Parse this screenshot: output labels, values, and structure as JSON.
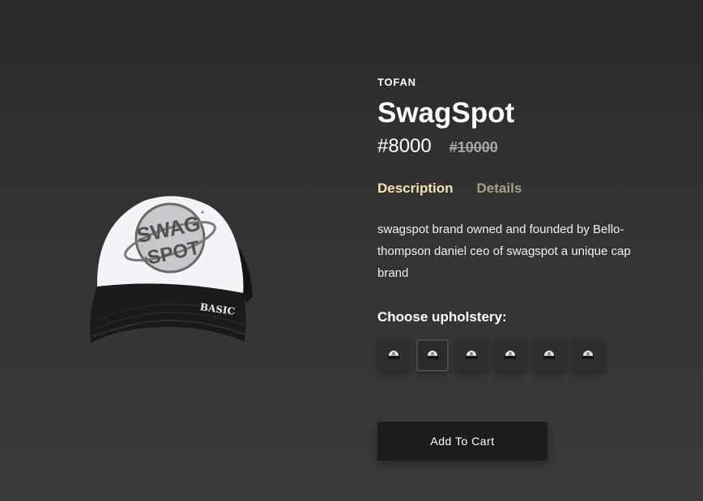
{
  "product": {
    "brand": "TOFAN",
    "name": "SwagSpot",
    "price": "#8000",
    "old_price": "#10000",
    "image_icon": "trucker-cap-image"
  },
  "tabs": [
    {
      "label": "Description",
      "active": true
    },
    {
      "label": "Details",
      "active": false
    }
  ],
  "description": "swagspot brand owned and founded by Bello-thompson daniel ceo of swagspot a unique cap brand",
  "upholstery": {
    "title": "Choose upholstery:",
    "options_count": 6,
    "selected_index": 1
  },
  "cart": {
    "button_label": "Add To Cart"
  },
  "colors": {
    "accent_tab": "#f2e3a6",
    "inactive_tab": "#a89e84",
    "button_bg": "#1c1c1c"
  }
}
